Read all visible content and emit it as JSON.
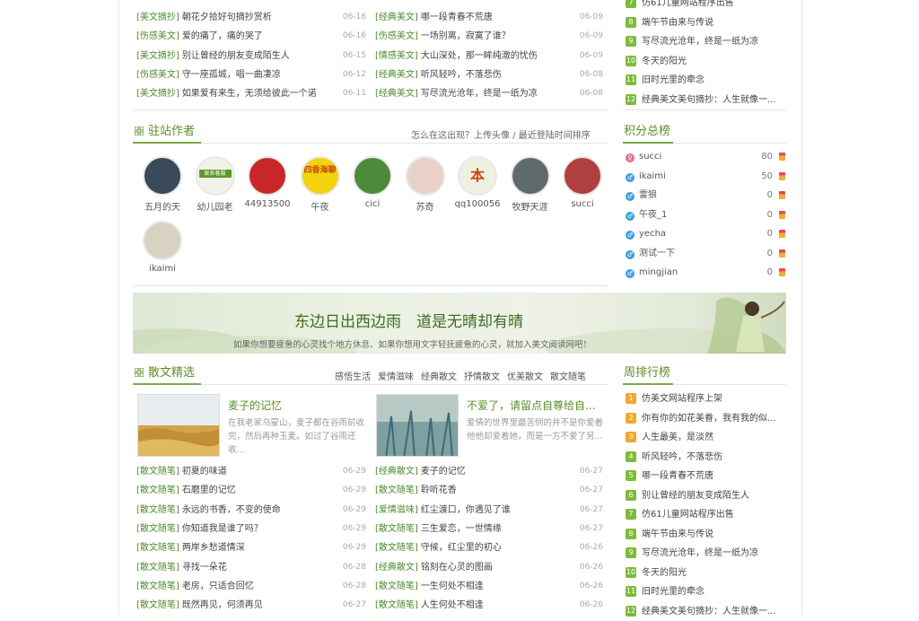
{
  "top_left_list": [
    {
      "cat": "[美文摘抄]",
      "title": "朝花夕拾好句摘抄赏析",
      "date": "06-16"
    },
    {
      "cat": "[伤感美文]",
      "title": "爱的痛了，痛的哭了",
      "date": "06-16"
    },
    {
      "cat": "[美文摘抄]",
      "title": "别让曾经的朋友变成陌生人",
      "date": "06-15"
    },
    {
      "cat": "[伤感美文]",
      "title": "守一座孤城，唱一曲凄凉",
      "date": "06-12"
    },
    {
      "cat": "[美文摘抄]",
      "title": "如果爱有来生，无须给彼此一个诺",
      "date": "06-11"
    }
  ],
  "top_mid_list": [
    {
      "cat": "[经典美文]",
      "title": "哪一段青春不荒唐",
      "date": "06-09"
    },
    {
      "cat": "[伤感美文]",
      "title": "一场别离，寂寞了谁？",
      "date": "06-09"
    },
    {
      "cat": "[情感美文]",
      "title": "大山深处，那一眸纯澈的忧伤",
      "date": "06-09"
    },
    {
      "cat": "[经典美文]",
      "title": "听风轻吟，不落悲伤",
      "date": "06-08"
    },
    {
      "cat": "[经典美文]",
      "title": "写尽流光沧年，终是一纸为凉",
      "date": "06-08"
    }
  ],
  "top_right_list": [
    {
      "n": "7",
      "title": "仿61儿童网站程序出售"
    },
    {
      "n": "8",
      "title": "端午节由来与传说"
    },
    {
      "n": "9",
      "title": "写尽流光沧年，终是一纸为凉"
    },
    {
      "n": "10",
      "title": "冬天的阳光"
    },
    {
      "n": "11",
      "title": "旧时光里的牵念"
    },
    {
      "n": "12",
      "title": "经典美文美句摘抄：人生就像一..."
    }
  ],
  "authors_section": {
    "title": "驻站作者",
    "links": "怎么在这出现？上传头像 / 最近登陆时间排序",
    "authors": [
      {
        "name": "五月的天",
        "color": "#3a4a5a"
      },
      {
        "name": "幼儿园老",
        "color": "#f2f2e8",
        "badge": "联系客服"
      },
      {
        "name": "44913500",
        "color": "#c8282a"
      },
      {
        "name": "午夜",
        "color": "#f3d20e",
        "text": "四香海聊"
      },
      {
        "name": "cici",
        "color": "#4f8a3a"
      },
      {
        "name": "苏奇",
        "color": "#e8d2c8"
      },
      {
        "name": "qq100056",
        "color": "#f0f0e0",
        "text": "本"
      },
      {
        "name": "牧野天涯",
        "color": "#5f6a6a"
      },
      {
        "name": "succi",
        "color": "#b04040"
      },
      {
        "name": "ikaimi",
        "color": "#d9d2c2"
      }
    ]
  },
  "score_section": {
    "title": "积分总榜",
    "rows": [
      {
        "name": "succi",
        "score": "80",
        "sym": "♀",
        "symcolor": "#e66a8f"
      },
      {
        "name": "ikaimi",
        "score": "50",
        "sym": "♂",
        "symcolor": "#3aa0dc"
      },
      {
        "name": "雷狼",
        "score": "0",
        "sym": "♂",
        "symcolor": "#3aa0dc"
      },
      {
        "name": "午夜_1",
        "score": "0",
        "sym": "♂",
        "symcolor": "#3aa0dc"
      },
      {
        "name": "yecha",
        "score": "0",
        "sym": "♂",
        "symcolor": "#3aa0dc"
      },
      {
        "name": "测试一下",
        "score": "0",
        "sym": "♂",
        "symcolor": "#3aa0dc"
      },
      {
        "name": "mingjian",
        "score": "0",
        "sym": "♂",
        "symcolor": "#3aa0dc"
      }
    ]
  },
  "banner": {
    "headline": "东边日出西边雨　道是无晴却有晴",
    "sub": "如果你想要疲惫的心灵找个地方休息、如果你想用文字轻抚疲惫的心灵，就加入美文阅读网吧！"
  },
  "prose_section": {
    "title": "散文精选",
    "tabs": [
      "感悟生活",
      "爱情滋味",
      "经典散文",
      "抒情散文",
      "优美散文",
      "散文随笔"
    ],
    "featured": [
      {
        "title": "麦子的记忆",
        "desc": "在我老家乌蒙山，麦子都在谷雨前收完，然后再种玉麦。如过了谷雨还收..."
      },
      {
        "title": "不爱了，请留点自尊给自...",
        "desc": "爱情的世界里最苦悯的并不是你爱着他他却爱着她，而是一方不爱了另..."
      }
    ],
    "left_list": [
      {
        "cat": "[散文随笔]",
        "title": "初夏的味道",
        "date": "06-29"
      },
      {
        "cat": "[散文随笔]",
        "title": "石磨里的记忆",
        "date": "06-29"
      },
      {
        "cat": "[散文随笔]",
        "title": "永远的书香，不变的使命",
        "date": "06-29"
      },
      {
        "cat": "[散文随笔]",
        "title": "你知道我是谁了吗？",
        "date": "06-29"
      },
      {
        "cat": "[散文随笔]",
        "title": "两岸乡愁道情深",
        "date": "06-29"
      },
      {
        "cat": "[散文随笔]",
        "title": "寻找一朵花",
        "date": "06-28"
      },
      {
        "cat": "[散文随笔]",
        "title": "老房，只适合回忆",
        "date": "06-28"
      },
      {
        "cat": "[散文随笔]",
        "title": "既然再见，何须再见",
        "date": "06-27"
      }
    ],
    "right_list": [
      {
        "cat": "[经典散文]",
        "title": "麦子的记忆",
        "date": "06-27"
      },
      {
        "cat": "[散文随笔]",
        "title": "聆听花香",
        "date": "06-27"
      },
      {
        "cat": "[爱情滋味]",
        "title": "红尘渡口，你遇见了谁",
        "date": "06-27"
      },
      {
        "cat": "[散文随笔]",
        "title": "三生爱恋，一世情缘",
        "date": "06-27"
      },
      {
        "cat": "[散文随笔]",
        "title": "守候，红尘里的初心",
        "date": "06-26"
      },
      {
        "cat": "[经典散文]",
        "title": "铭刻在心灵的图画",
        "date": "06-26"
      },
      {
        "cat": "[散文随笔]",
        "title": "一生何处不相逢",
        "date": "06-26"
      },
      {
        "cat": "[散文随笔]",
        "title": "人生何处不相逢",
        "date": "06-26"
      }
    ]
  },
  "weekly_section": {
    "title": "周排行榜",
    "rows": [
      {
        "n": "1",
        "title": "仿美文网站程序上架"
      },
      {
        "n": "2",
        "title": "你有你的如花美眷，我有我的似..."
      },
      {
        "n": "3",
        "title": "人生最美，是淡然"
      },
      {
        "n": "4",
        "title": "听风轻吟，不落悲伤"
      },
      {
        "n": "5",
        "title": "哪一段青春不荒唐"
      },
      {
        "n": "6",
        "title": "别让曾经的朋友变成陌生人"
      },
      {
        "n": "7",
        "title": "仿61儿童网站程序出售"
      },
      {
        "n": "8",
        "title": "端午节由来与传说"
      },
      {
        "n": "9",
        "title": "写尽流光沧年，终是一纸为凉"
      },
      {
        "n": "10",
        "title": "冬天的阳光"
      },
      {
        "n": "11",
        "title": "旧时光里的牵念"
      },
      {
        "n": "12",
        "title": "经典美文美句摘抄：人生就像一..."
      }
    ]
  }
}
